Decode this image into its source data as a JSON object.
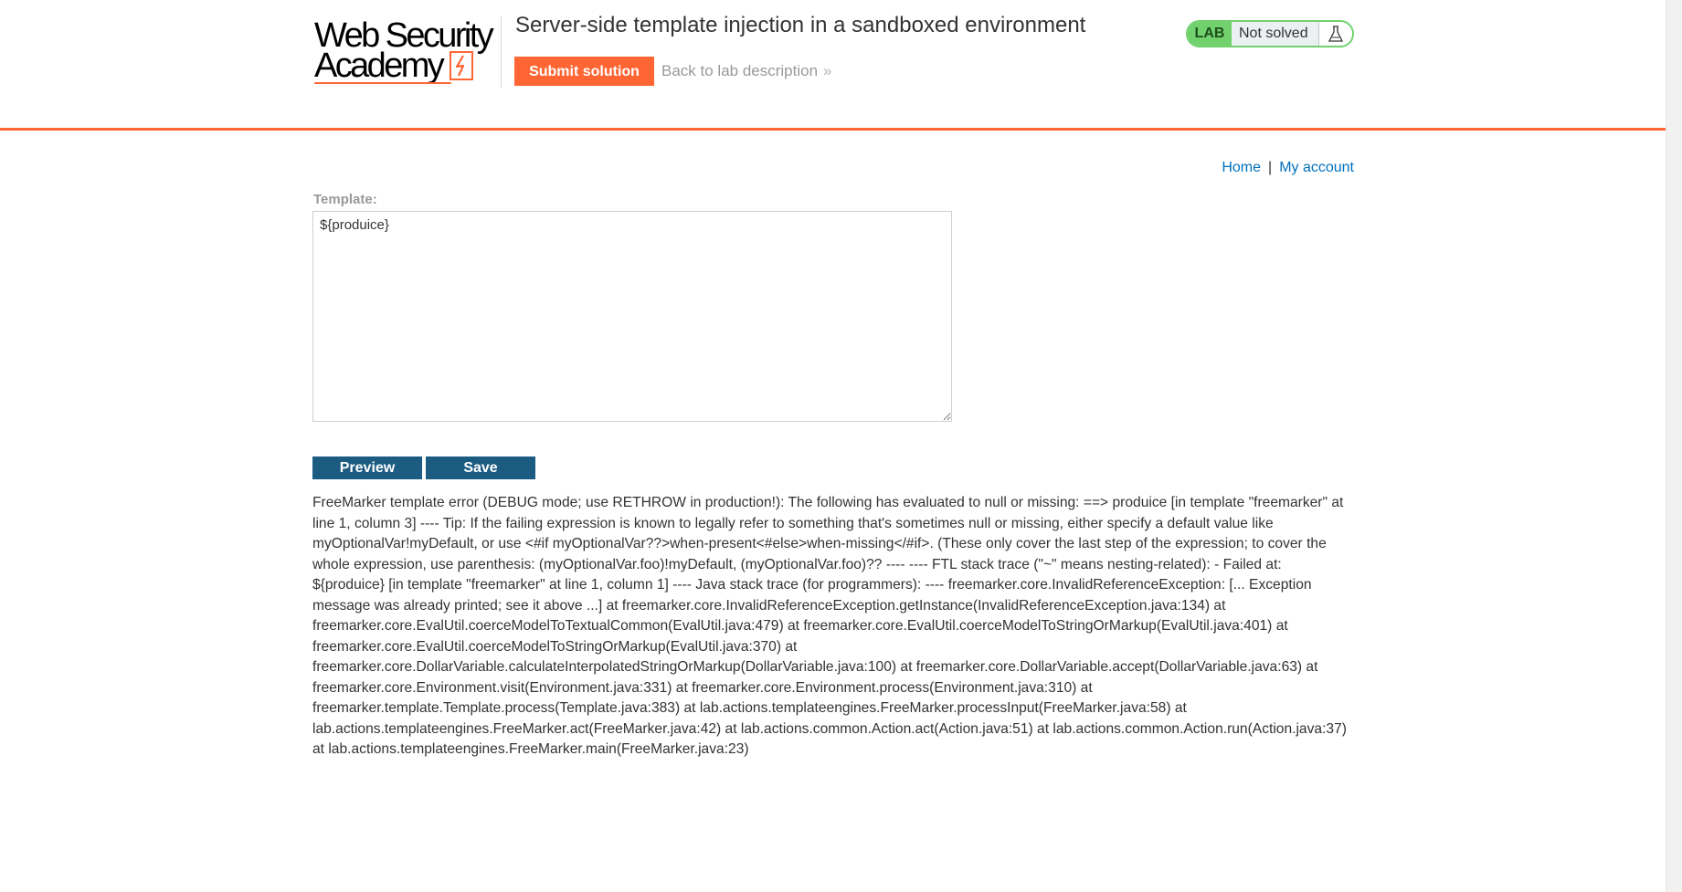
{
  "logo": {
    "line1": "Web Security",
    "line2": "Academy"
  },
  "header": {
    "title": "Server-side template injection in a sandboxed environment",
    "submit_label": "Submit solution",
    "back_label": "Back to lab description",
    "back_chevron": "»"
  },
  "status": {
    "tag": "LAB",
    "text": "Not solved",
    "icon": "flask-icon"
  },
  "nav": {
    "home": "Home",
    "separator": "|",
    "account": "My account"
  },
  "form": {
    "label": "Template:",
    "value": "${produice}",
    "preview_label": "Preview",
    "save_label": "Save"
  },
  "error": {
    "message": "FreeMarker template error (DEBUG mode; use RETHROW in production!): The following has evaluated to null or missing: ==> produice [in template \"freemarker\" at line 1, column 3] ---- Tip: If the failing expression is known to legally refer to something that's sometimes null or missing, either specify a default value like myOptionalVar!myDefault, or use <#if myOptionalVar??>when-present<#else>when-missing</#if>. (These only cover the last step of the expression; to cover the whole expression, use parenthesis: (myOptionalVar.foo)!myDefault, (myOptionalVar.foo)?? ---- ---- FTL stack trace (\"~\" means nesting-related): - Failed at: ${produice} [in template \"freemarker\" at line 1, column 1] ---- Java stack trace (for programmers): ---- freemarker.core.InvalidReferenceException: [... Exception message was already printed; see it above ...] at freemarker.core.InvalidReferenceException.getInstance(InvalidReferenceException.java:134) at freemarker.core.EvalUtil.coerceModelToTextualCommon(EvalUtil.java:479) at freemarker.core.EvalUtil.coerceModelToStringOrMarkup(EvalUtil.java:401) at freemarker.core.EvalUtil.coerceModelToStringOrMarkup(EvalUtil.java:370) at freemarker.core.DollarVariable.calculateInterpolatedStringOrMarkup(DollarVariable.java:100) at freemarker.core.DollarVariable.accept(DollarVariable.java:63) at freemarker.core.Environment.visit(Environment.java:331) at freemarker.core.Environment.process(Environment.java:310) at freemarker.template.Template.process(Template.java:383) at lab.actions.templateengines.FreeMarker.processInput(FreeMarker.java:58) at lab.actions.templateengines.FreeMarker.act(FreeMarker.java:42) at lab.actions.common.Action.act(Action.java:51) at lab.actions.common.Action.run(Action.java:37) at lab.actions.templateengines.FreeMarker.main(FreeMarker.java:23)"
  },
  "colors": {
    "accent": "#ff6633",
    "primary_button": "#1c5c82",
    "link": "#0071bc",
    "status_green": "#70d16d"
  }
}
